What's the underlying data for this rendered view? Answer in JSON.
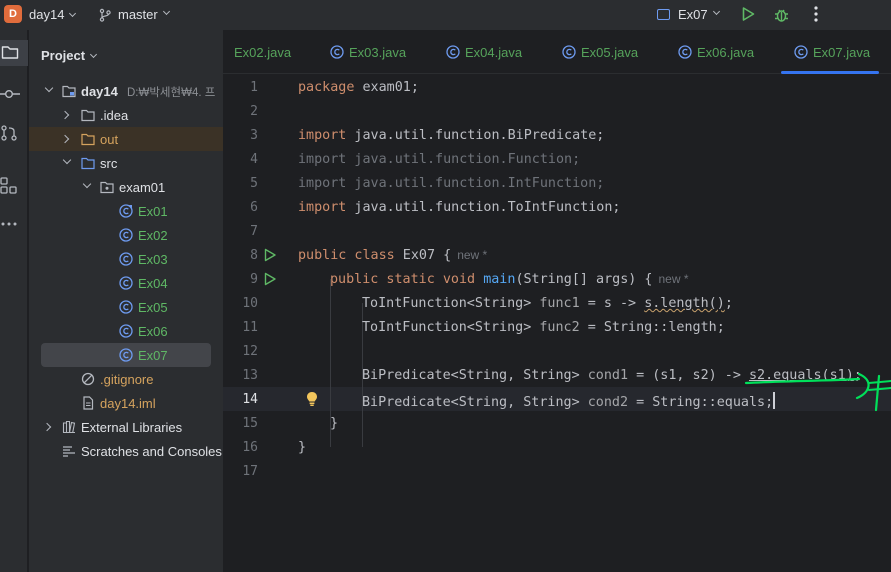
{
  "titlebar": {
    "project_badge": "D",
    "project_name": "day14",
    "branch": "master",
    "run_config": "Ex07",
    "icons": [
      "chevron-down-icon",
      "git-branch-icon",
      "run-icon",
      "debug-icon",
      "more-icon"
    ]
  },
  "toolstrip": {
    "items": [
      "project-folder-icon",
      "commit-icon",
      "pull-request-icon",
      "plugins-icon",
      "more-icon"
    ]
  },
  "project_panel": {
    "title": "Project",
    "tree": [
      {
        "label": "day14",
        "detail": "D:₩박세현₩4. 프",
        "type": "module"
      },
      {
        "label": ".idea",
        "type": "folder"
      },
      {
        "label": "out",
        "type": "folder-excluded"
      },
      {
        "label": "src",
        "type": "folder-source"
      },
      {
        "label": "exam01",
        "type": "package"
      },
      {
        "label": "Ex01",
        "type": "class"
      },
      {
        "label": "Ex02",
        "type": "class"
      },
      {
        "label": "Ex03",
        "type": "class"
      },
      {
        "label": "Ex04",
        "type": "class"
      },
      {
        "label": "Ex05",
        "type": "class"
      },
      {
        "label": "Ex06",
        "type": "class"
      },
      {
        "label": "Ex07",
        "type": "class",
        "selected": true
      },
      {
        "label": ".gitignore",
        "type": "ignored-file"
      },
      {
        "label": "day14.iml",
        "type": "file"
      },
      {
        "label": "External Libraries",
        "type": "libraries"
      },
      {
        "label": "Scratches and Consoles",
        "type": "scratches"
      }
    ]
  },
  "tabs": [
    {
      "label": "Ex02.java"
    },
    {
      "label": "Ex03.java"
    },
    {
      "label": "Ex04.java"
    },
    {
      "label": "Ex05.java"
    },
    {
      "label": "Ex06.java"
    },
    {
      "label": "Ex07.java",
      "active": true
    }
  ],
  "editor": {
    "current_line": 14,
    "lines": [
      {
        "n": "1"
      },
      {
        "n": "2"
      },
      {
        "n": "3"
      },
      {
        "n": "4"
      },
      {
        "n": "5"
      },
      {
        "n": "6"
      },
      {
        "n": "7"
      },
      {
        "n": "8"
      },
      {
        "n": "9"
      },
      {
        "n": "10"
      },
      {
        "n": "11"
      },
      {
        "n": "12"
      },
      {
        "n": "13"
      },
      {
        "n": "14"
      },
      {
        "n": "15"
      },
      {
        "n": "16"
      },
      {
        "n": "17"
      }
    ],
    "code": {
      "l1_kw": "package",
      "l1_rest": " exam01;",
      "l3_kw": "import",
      "l3_rest": " java.util.function.BiPredicate;",
      "l4": "import java.util.function.Function;",
      "l5": "import java.util.function.IntFunction;",
      "l6_kw": "import",
      "l6_rest": " java.util.function.ToIntFunction;",
      "l8_kw": "public class",
      "l8_rest": " Ex07 {",
      "l8_hint": "new *",
      "l9_kw": "public static void",
      "l9_fn": "main",
      "l9_rest": "(String[] args) {",
      "l9_hint": "new *",
      "l10_a": "ToIntFunction<String> ",
      "l10_var": "func1",
      "l10_b": " = s -> ",
      "l10_c": "s.length()",
      "l10_d": ";",
      "l11_a": "ToIntFunction<String> ",
      "l11_var": "func2",
      "l11_b": " = String::length;",
      "l13_a": "BiPredicate<String, String> ",
      "l13_var": "cond1",
      "l13_b": " = (s1, s2) -> ",
      "l13_c": "s2.equals(s1)",
      "l13_d": ";",
      "l14_a": "BiPredicate<String, String> ",
      "l14_var": "cond2",
      "l14_b": " = String::equals;",
      "l15": "}",
      "l16": "}"
    }
  },
  "colors": {
    "accent": "#3574f0",
    "class_file": "#5fb865",
    "keyword": "#cf8e6d",
    "method": "#56a8f5",
    "annotation_pen": "#00e05a"
  }
}
